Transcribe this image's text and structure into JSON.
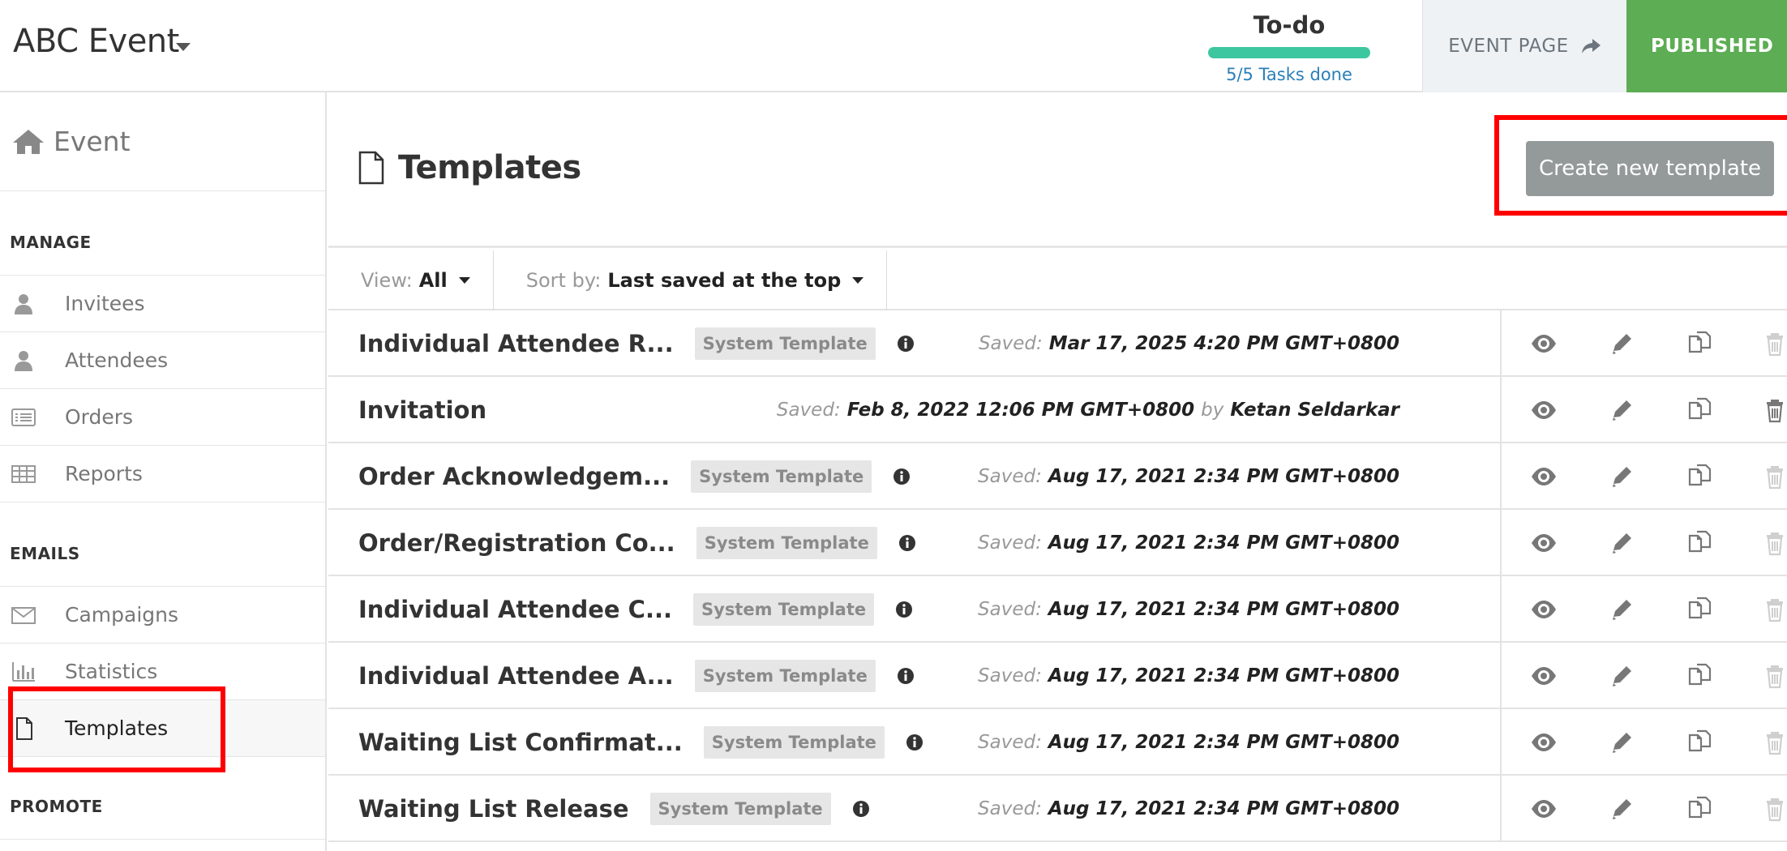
{
  "header": {
    "event_title": "ABC Event",
    "todo_label": "To-do",
    "todo_status": "5/5 Tasks done",
    "todo_progress": 1.0,
    "event_page_label": "EVENT PAGE",
    "published_label": "PUBLISHED"
  },
  "sidebar": {
    "home_label": "Event",
    "sections": {
      "manage": "MANAGE",
      "emails": "EMAILS",
      "promote": "PROMOTE"
    },
    "manage_items": [
      {
        "label": "Invitees",
        "icon": "user-icon"
      },
      {
        "label": "Attendees",
        "icon": "user-icon"
      },
      {
        "label": "Orders",
        "icon": "list-icon"
      },
      {
        "label": "Reports",
        "icon": "table-icon"
      }
    ],
    "email_items": [
      {
        "label": "Campaigns",
        "icon": "envelope-icon"
      },
      {
        "label": "Statistics",
        "icon": "bar-chart-icon"
      },
      {
        "label": "Templates",
        "icon": "file-icon",
        "active": true
      }
    ]
  },
  "main": {
    "title": "Templates",
    "create_button": "Create new template",
    "filters": {
      "view_label": "View:",
      "view_value": "All",
      "sort_label": "Sort by:",
      "sort_value": "Last saved at the top"
    },
    "saved_label": "Saved:",
    "by_label": "by",
    "templates": [
      {
        "name": "Individual Attendee R...",
        "badge": "System Template",
        "saved": "Mar 17, 2025 4:20 PM GMT+0800",
        "author": "",
        "deletable": false
      },
      {
        "name": "Invitation",
        "badge": "",
        "saved": "Feb 8, 2022 12:06 PM GMT+0800",
        "author": "Ketan Seldarkar",
        "deletable": true
      },
      {
        "name": "Order Acknowledgem...",
        "badge": "System Template",
        "saved": "Aug 17, 2021 2:34 PM GMT+0800",
        "author": "",
        "deletable": false
      },
      {
        "name": "Order/Registration Co...",
        "badge": "System Template",
        "saved": "Aug 17, 2021 2:34 PM GMT+0800",
        "author": "",
        "deletable": false
      },
      {
        "name": "Individual Attendee C...",
        "badge": "System Template",
        "saved": "Aug 17, 2021 2:34 PM GMT+0800",
        "author": "",
        "deletable": false
      },
      {
        "name": "Individual Attendee A...",
        "badge": "System Template",
        "saved": "Aug 17, 2021 2:34 PM GMT+0800",
        "author": "",
        "deletable": false
      },
      {
        "name": "Waiting List Confirmat...",
        "badge": "System Template",
        "saved": "Aug 17, 2021 2:34 PM GMT+0800",
        "author": "",
        "deletable": false
      },
      {
        "name": "Waiting List Release",
        "badge": "System Template",
        "saved": "Aug 17, 2021 2:34 PM GMT+0800",
        "author": "",
        "deletable": false
      }
    ]
  },
  "colors": {
    "accent_green": "#5cad53",
    "progress_teal": "#3dc7a0",
    "link_blue": "#2a7fb8",
    "highlight_red": "#ff0000",
    "button_gray": "#949a9a"
  }
}
